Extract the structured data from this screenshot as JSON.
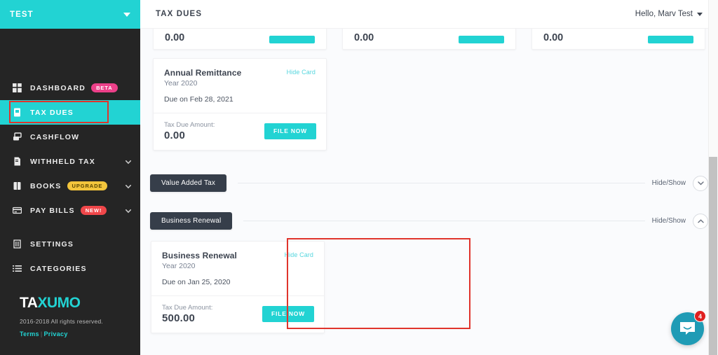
{
  "sidebar": {
    "org": {
      "name": "TEST",
      "caret_icon": "chevron-down-icon"
    },
    "items": [
      {
        "label": "DASHBOARD",
        "icon": "grid-icon",
        "badge": "BETA",
        "badge_kind": "beta",
        "chevron": false,
        "active": false
      },
      {
        "label": "TAX DUES",
        "icon": "document-icon",
        "badge": null,
        "badge_kind": null,
        "chevron": false,
        "active": true
      },
      {
        "label": "CASHFLOW",
        "icon": "layers-icon",
        "badge": null,
        "badge_kind": null,
        "chevron": false,
        "active": false
      },
      {
        "label": "WITHHELD TAX",
        "icon": "file-icon",
        "badge": null,
        "badge_kind": null,
        "chevron": true,
        "active": false
      },
      {
        "label": "BOOKS",
        "icon": "book-icon",
        "badge": "UPGRADE",
        "badge_kind": "upgrade",
        "chevron": true,
        "active": false
      },
      {
        "label": "PAY BILLS",
        "icon": "card-icon",
        "badge": "NEW!",
        "badge_kind": "new",
        "chevron": true,
        "active": false
      }
    ],
    "secondary_items": [
      {
        "label": "SETTINGS",
        "icon": "sliders-icon"
      },
      {
        "label": "CATEGORIES",
        "icon": "list-icon"
      }
    ],
    "brand": {
      "part_white": "TA",
      "part_teal": "XUMO"
    },
    "copyright": "2016-2018 All rights reserved.",
    "legal": {
      "terms": "Terms",
      "separator": "|",
      "privacy": "Privacy"
    }
  },
  "header": {
    "title": "TAX DUES",
    "user_greeting": "Hello, Marv Test",
    "caret_icon": "chevron-down-icon"
  },
  "clipped_cards": [
    {
      "amount": "0.00"
    },
    {
      "amount": "0.00"
    },
    {
      "amount": "0.00"
    }
  ],
  "cards": {
    "annual_remittance": {
      "title": "Annual Remittance",
      "year": "Year 2020",
      "due": "Due on Feb 28, 2021",
      "hide_card": "Hide Card",
      "due_label": "Tax Due Amount:",
      "due_amount": "0.00",
      "file_now": "FILE NOW"
    },
    "business_renewal": {
      "title": "Business Renewal",
      "year": "Year 2020",
      "due": "Due on Jan 25, 2020",
      "hide_card": "Hide Card",
      "due_label": "Tax Due Amount:",
      "due_amount": "500.00",
      "file_now": "FILE NOW"
    }
  },
  "sections": [
    {
      "label": "Value Added Tax",
      "toggle_label": "Hide/Show",
      "state": "collapsed",
      "icon": "chevron-down-icon"
    },
    {
      "label": "Business Renewal",
      "toggle_label": "Hide/Show",
      "state": "expanded",
      "icon": "chevron-up-icon"
    }
  ],
  "intercom": {
    "icon": "chat-bubble-icon",
    "unread_count": "4"
  },
  "colors": {
    "teal": "#22d3d3",
    "sidebar": "#252525",
    "pill": "#363e4a",
    "highlight": "#e0342c",
    "badge_beta": "#ec4089",
    "badge_upgrade": "#f3c53c",
    "badge_new": "#f0474a",
    "intercom": "#1f9bb5"
  }
}
